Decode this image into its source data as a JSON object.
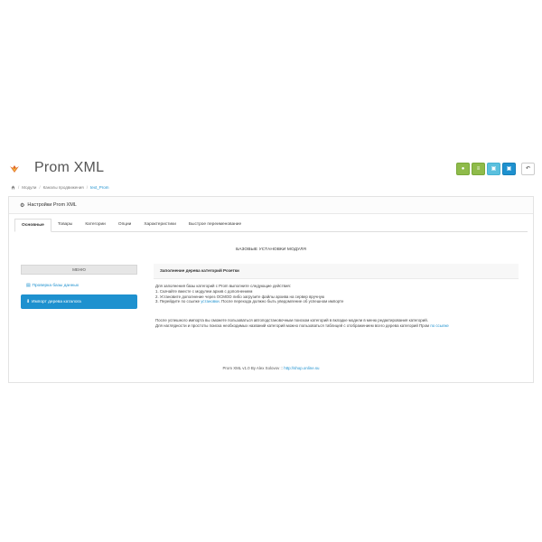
{
  "header": {
    "title": "Prom XML",
    "toolbar": [
      {
        "icon": "circle-icon",
        "color": "#8fbb4a",
        "glyph": "●"
      },
      {
        "icon": "list-icon",
        "color": "#8fbb4a",
        "glyph": "≡"
      },
      {
        "icon": "save-icon",
        "color": "#5bc0de",
        "glyph": "▣"
      },
      {
        "icon": "save-icon",
        "color": "#1e91cf",
        "glyph": "▣"
      },
      {
        "icon": "back-icon",
        "color": "#ffffff",
        "glyph": "↶"
      }
    ]
  },
  "breadcrumb": {
    "items": [
      "Модули",
      "Каналы продвижения",
      "text_Prom"
    ]
  },
  "panel": {
    "heading": "Настройки Prom XML",
    "tabs": [
      "Основные",
      "Товары",
      "Категории",
      "Опции",
      "Характеристики",
      "Быстрое переименование"
    ],
    "section_title": "БАЗОВЫЕ УСТАНОВКИ МОДУЛЯ"
  },
  "menu": {
    "title": "МЕНЮ",
    "items": [
      {
        "label": "Проверка базы данных",
        "active": false
      },
      {
        "label": "Импорт дерева каталога",
        "active": true
      }
    ]
  },
  "content": {
    "heading": "Заполнение дерева категорий Розетки",
    "intro": "Для заполнения базы категорий с Prom выполните следующие действия:",
    "step1": "1. Скачайте вместе с модулем архив с дополнением",
    "step2": "2. Установите дополнение через OCMOD либо загрузите файлы архива на сервер вручную",
    "step3_prefix": "3. Перейдите по ссылке ",
    "step3_link": "установки",
    "step3_suffix": ". После перехода должно быть уведомление об успешном импорте",
    "para2_line1": "После успешного импорта вы сможете пользоваться автоподстановочным поиском категорий в вкладке модели в меню редактирования категорий.",
    "para2_line2": "Для наглядности и простоты поиска необходимых названий категорий можно пользоваться таблицей с отображением всего дерева категорий Пром ",
    "para2_link": "по ссылке"
  },
  "footer": {
    "text": "Prom XML v1.0 By Alex Solovov :: ",
    "link": "http://shop.online.su"
  }
}
